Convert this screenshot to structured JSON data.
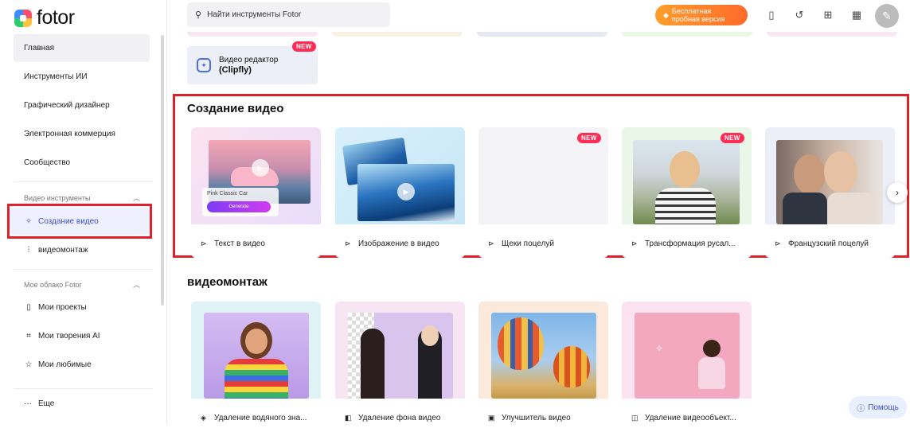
{
  "app": {
    "logo_text": "fotor"
  },
  "sidebar": {
    "nav": [
      {
        "label": "Главная"
      },
      {
        "label": "Инструменты ИИ"
      },
      {
        "label": "Графический дизайнер"
      },
      {
        "label": "Электронная коммерция"
      },
      {
        "label": "Сообщество"
      }
    ],
    "video_section": {
      "title": "Видео инструменты",
      "items": [
        {
          "label": "Создание видео",
          "icon": "magic-wand-icon"
        },
        {
          "label": "видеомонтаж",
          "icon": "sliders-icon"
        }
      ]
    },
    "cloud_section": {
      "title": "Мое облако Fotor",
      "items": [
        {
          "label": "Мои проекты",
          "icon": "file-icon"
        },
        {
          "label": "Мои творения AI",
          "icon": "frame-icon"
        },
        {
          "label": "Мои любимые",
          "icon": "star-icon"
        }
      ]
    },
    "more_label": "Еще"
  },
  "topbar": {
    "search_placeholder": "Найти инструменты Fotor",
    "trial_line1": "Бесплатная",
    "trial_line2": "пробная версия"
  },
  "clipfly": {
    "line1": "Видео редактор",
    "line2": "(Clipfly)",
    "badge": "NEW"
  },
  "video_creation": {
    "title": "Создание видео",
    "cards": [
      {
        "label": "Текст в видео",
        "prompt": "Pink Classic Car",
        "button": "Generate"
      },
      {
        "label": "Изображение в видео"
      },
      {
        "label": "Щеки поцелуй",
        "badge": "NEW"
      },
      {
        "label": "Трансформация русал...",
        "badge": "NEW"
      },
      {
        "label": "Французский поцелуй"
      }
    ]
  },
  "video_editing": {
    "title": "видеомонтаж",
    "cards": [
      {
        "label": "Удаление водяного зна..."
      },
      {
        "label": "Удаление фона видео"
      },
      {
        "label": "Улучшитель видео"
      },
      {
        "label": "Удаление видеообъект..."
      }
    ]
  },
  "help": {
    "label": "Помощь"
  },
  "colors": {
    "accent": "#3b4fd8",
    "highlight": "#e0202a",
    "badge": "#ff2d55",
    "trial": "#ff7a2b"
  }
}
